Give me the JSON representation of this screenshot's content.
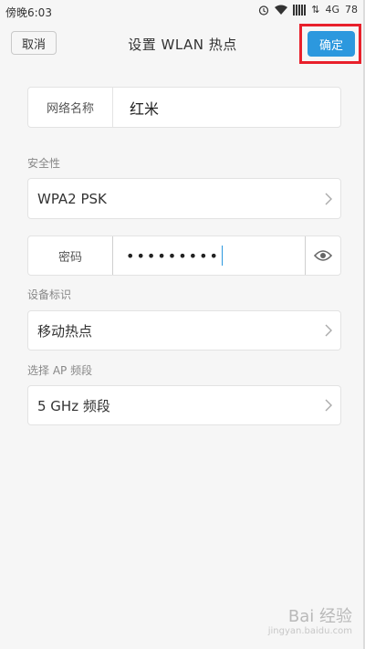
{
  "status_bar": {
    "time": "傍晚6:03",
    "network": "4G",
    "battery": "78"
  },
  "header": {
    "cancel_label": "取消",
    "title": "设置 WLAN 热点",
    "confirm_label": "确定"
  },
  "network_name": {
    "label": "网络名称",
    "value": "红米"
  },
  "security": {
    "section_label": "安全性",
    "value": "WPA2 PSK"
  },
  "password": {
    "label": "密码",
    "value": "•••••••••"
  },
  "device_id": {
    "section_label": "设备标识",
    "value": "移动热点"
  },
  "ap_band": {
    "section_label": "选择 AP 频段",
    "value": "5 GHz 频段"
  },
  "watermark": {
    "main": "Bai 经验",
    "sub": "jingyan.baidu.com"
  },
  "colors": {
    "accent": "#2c98de",
    "highlight": "#e8202b"
  }
}
